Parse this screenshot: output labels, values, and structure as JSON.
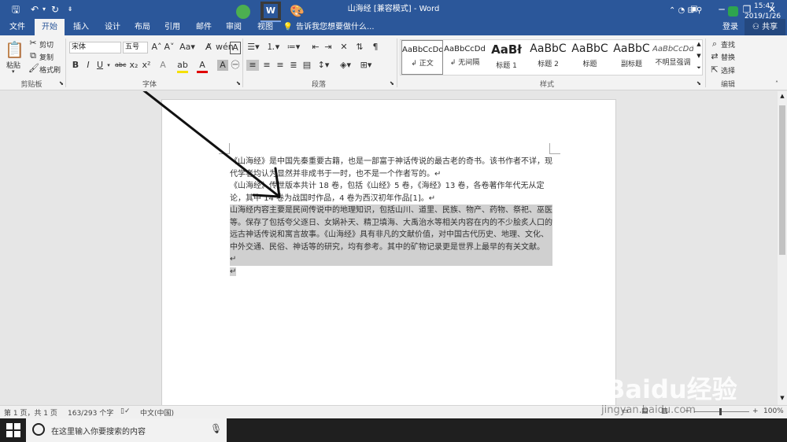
{
  "title": "山海经 [兼容模式] - Word",
  "window": {
    "login": "登录",
    "share": "共享"
  },
  "tabs": [
    "文件",
    "开始",
    "插入",
    "设计",
    "布局",
    "引用",
    "邮件",
    "审阅",
    "视图"
  ],
  "tell_me": "告诉我您想要做什么...",
  "ribbon": {
    "clipboard": {
      "paste": "粘贴",
      "cut": "剪切",
      "copy": "复制",
      "format_painter": "格式刷",
      "label": "剪贴板"
    },
    "font": {
      "name": "宋体",
      "size": "五号",
      "label": "字体"
    },
    "paragraph": {
      "label": "段落"
    },
    "styles": {
      "label": "样式",
      "items": [
        {
          "preview": "AaBbCcDd",
          "name": "↲ 正文"
        },
        {
          "preview": "AaBbCcDd",
          "name": "↲ 无间隔"
        },
        {
          "preview": "AaBł",
          "name": "标题 1"
        },
        {
          "preview": "AaBbC",
          "name": "标题 2"
        },
        {
          "preview": "AaBbC",
          "name": "标题"
        },
        {
          "preview": "AaBbC",
          "name": "副标题"
        },
        {
          "preview": "AaBbCcDd",
          "name": "不明显强调"
        }
      ]
    },
    "editing": {
      "find": "查找",
      "replace": "替换",
      "select": "选择",
      "label": "编辑"
    }
  },
  "document": {
    "p1": "《山海经》是中国先秦重要古籍，也是一部富于神话传说的最古老的奇书。该书作者不详，现代学者均认为显然并非成书于一时，也不是一个作者写的。↵",
    "p2": "《山海经》传世版本共计 18 卷，包括《山经》5 卷，《海经》13 卷，各卷著作年代无从定论，其中 14 卷为战国时作品，4 卷为西汉初年作品[1]。↵",
    "p3": "山海经内容主要是民间传说中的地理知识，包括山川、道里、民族、物产、药物、祭祀、巫医等。保存了包括夸父逐日、女娲补天、精卫填海、大禹治水等相关内容在内的不少脍炙人口的远古神话传说和寓言故事。《山海经》具有非凡的文献价值，对中国古代历史、地理、文化、中外交通、民俗、神话等的研究，均有参考。其中的矿物记录更是世界上最早的有关文献。 ↵",
    "p4": "↵"
  },
  "status": {
    "page": "第 1 页，共 1 页",
    "words": "163/293 个字",
    "lang": "中文(中国)",
    "zoom": "100%"
  },
  "taskbar": {
    "search_placeholder": "在这里输入你要搜索的内容",
    "time": "15:47",
    "date": "2019/1/26"
  },
  "watermark": {
    "brand": "Baidu经验",
    "url": "jingyan.baidu.com"
  },
  "colors": {
    "word_blue": "#2b579a",
    "selection": "#d0d0d0",
    "arrow": "#111111"
  }
}
